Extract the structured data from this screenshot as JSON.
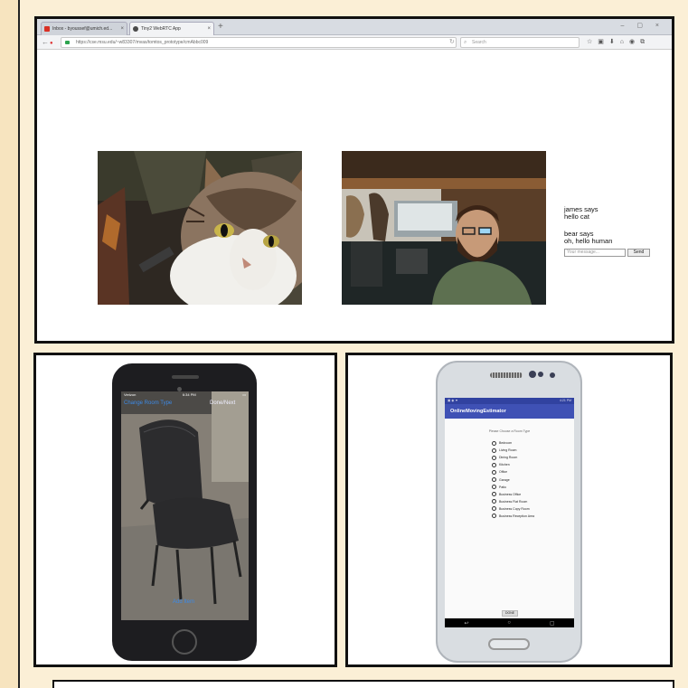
{
  "browser": {
    "tabs": [
      {
        "title": "Inbox - byoussef@umich.ed...",
        "icon": "gmail-icon",
        "active": false
      },
      {
        "title": "Tiny2 WebRTC App",
        "icon": "webrtc-tab-icon",
        "active": true
      }
    ],
    "new_tab_symbol": "+",
    "window_controls": "– ▢ ×",
    "url": "https://cse.msu.edu/~w83307/mvas/tomtos_prototype/cmAbbc009",
    "search_placeholder": "Search",
    "toolbar_icons": [
      "star-icon",
      "reading-list-icon",
      "download-icon",
      "home-icon",
      "pocket-icon",
      "extension-icon"
    ]
  },
  "video_call": {
    "remote_feed": "cat-video",
    "local_feed": "person-video"
  },
  "chat": {
    "messages": [
      {
        "sender": "james says",
        "text": "hello cat"
      },
      {
        "sender": "bear says",
        "text": "oh, hello human"
      }
    ],
    "input_placeholder": "Your message...",
    "send_label": "Send"
  },
  "iphone_app": {
    "carrier": "Verizon",
    "time": "6:34 PM",
    "change_room_type": "Change Room Type",
    "done": "Done/Next",
    "add_item": "Add Item"
  },
  "android_app": {
    "status_time": "4:21 PM",
    "app_title": "OnlineMovingEstimator",
    "prompt": "Please Choose a Room Type",
    "room_types": [
      "Bedroom",
      "Living Room",
      "Dining Room",
      "Kitchen",
      "Office",
      "Garage",
      "Patio",
      "Business Office",
      "Business Flat Room",
      "Business Copy Room",
      "Business Reception Area"
    ],
    "done_label": "DONE"
  }
}
